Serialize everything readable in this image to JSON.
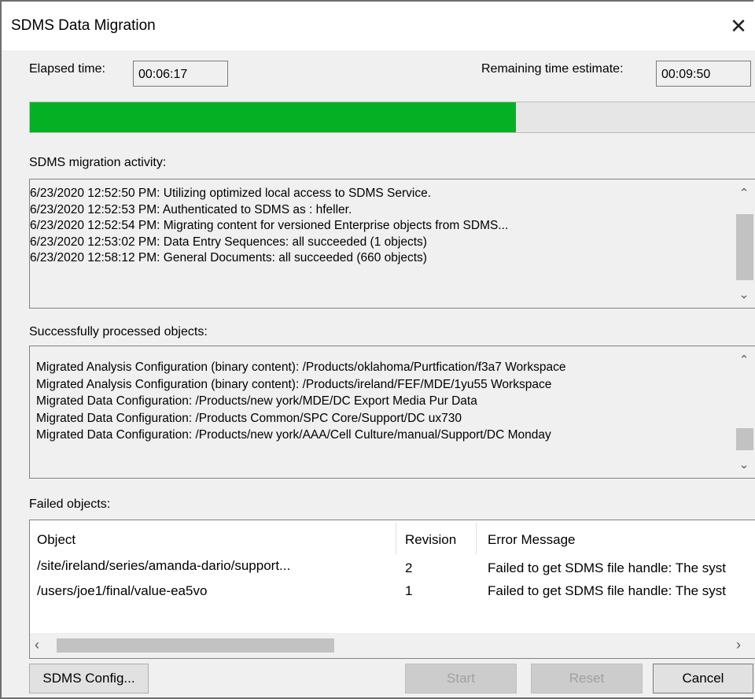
{
  "window": {
    "title": "SDMS Data Migration",
    "close_icon": "close-icon"
  },
  "timing": {
    "elapsed_label": "Elapsed time:",
    "elapsed_value": "00:06:17",
    "remaining_label": "Remaining time estimate:",
    "remaining_value": "00:09:50"
  },
  "progress": {
    "fraction": 0.67,
    "fill_color": "#06b025"
  },
  "activity": {
    "label": "SDMS migration activity:",
    "lines": [
      "6/23/2020 12:52:50 PM: Utilizing optimized local access to SDMS Service.",
      "6/23/2020 12:52:53 PM: Authenticated to SDMS as : hfeller.",
      "6/23/2020 12:52:54 PM: Migrating content for versioned Enterprise objects from SDMS...",
      "6/23/2020 12:53:02 PM: Data Entry Sequences: all succeeded (1 objects)",
      "6/23/2020 12:58:12 PM: General Documents: all succeeded (660 objects)"
    ]
  },
  "processed": {
    "label": "Successfully processed objects:",
    "lines": [
      "Migrated Analysis Configuration (binary content): /Products/oklahoma/Purtfication/f3a7 Workspace",
      "Migrated Analysis Configuration (binary content): /Products/ireland/FEF/MDE/1yu55 Workspace",
      "Migrated Data Configuration: /Products/new york/MDE/DC Export Media Pur Data",
      "Migrated Data Configuration: /Products Common/SPC Core/Support/DC ux730",
      "Migrated Data Configuration: /Products/new york/AAA/Cell Culture/manual/Support/DC Monday"
    ]
  },
  "failed": {
    "label": "Failed objects:",
    "columns": [
      "Object",
      "Revision",
      "Error Message"
    ],
    "rows": [
      [
        "/site/ireland/series/amanda-dario/support...",
        "2",
        "Failed to get SDMS file handle: The syst"
      ],
      [
        "/users/joe1/final/value-ea5vo",
        "1",
        "Failed to get SDMS file handle: The syst"
      ]
    ]
  },
  "buttons": {
    "config": "SDMS Config...",
    "start": "Start",
    "reset": "Reset",
    "cancel": "Cancel"
  }
}
